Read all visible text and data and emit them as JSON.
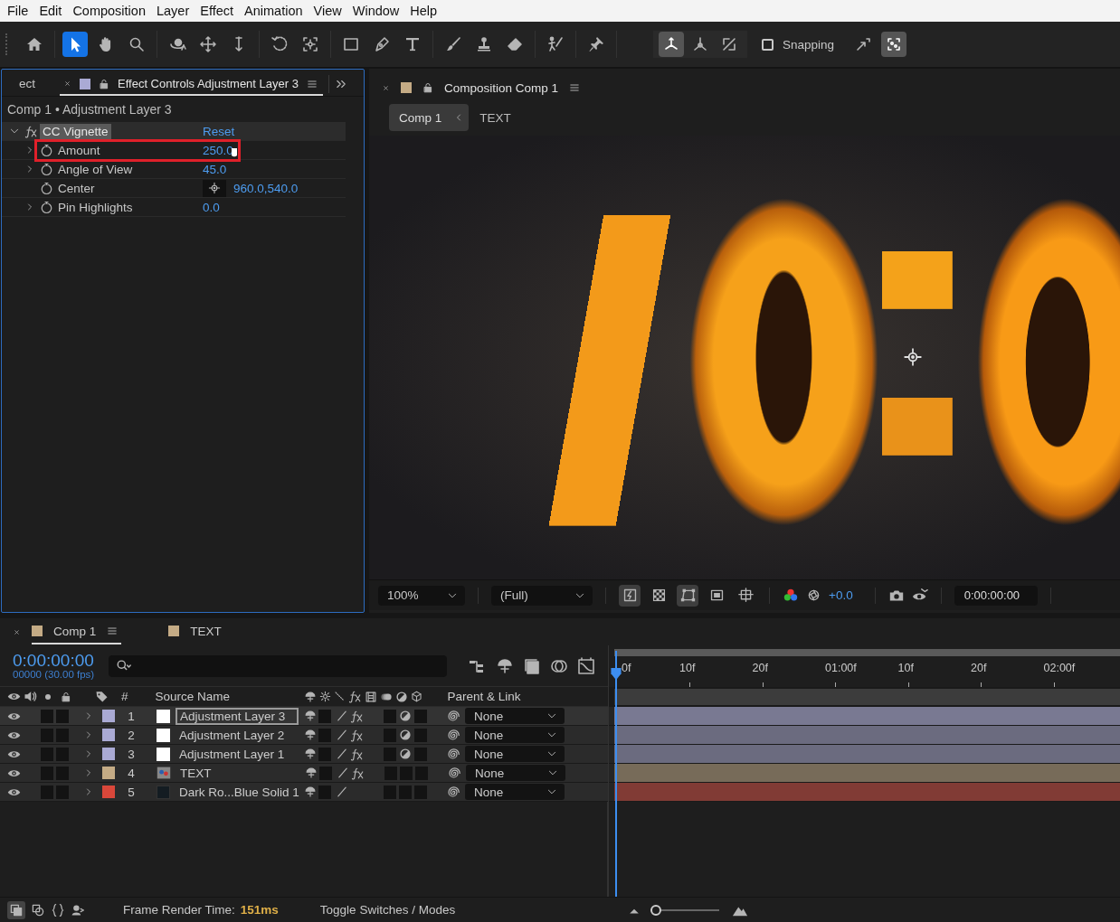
{
  "menu": [
    "File",
    "Edit",
    "Composition",
    "Layer",
    "Effect",
    "Animation",
    "View",
    "Window",
    "Help"
  ],
  "tool_groups": [
    [
      {
        "kind": "home",
        "selected": false
      }
    ],
    [
      {
        "kind": "selection",
        "selected": true
      },
      {
        "kind": "hand",
        "selected": false
      },
      {
        "kind": "zoom",
        "selected": false
      }
    ],
    [
      {
        "kind": "orbit",
        "selected": false
      },
      {
        "kind": "pan",
        "selected": false
      },
      {
        "kind": "dolly",
        "selected": false
      }
    ],
    [
      {
        "kind": "rotate",
        "selected": false
      },
      {
        "kind": "anchor",
        "selected": false
      }
    ],
    [
      {
        "kind": "rectangle",
        "selected": false
      },
      {
        "kind": "pen",
        "selected": false
      },
      {
        "kind": "type",
        "selected": false
      }
    ],
    [
      {
        "kind": "brush",
        "selected": false
      },
      {
        "kind": "stamp",
        "selected": false
      },
      {
        "kind": "eraser",
        "selected": false
      }
    ],
    [
      {
        "kind": "roto",
        "selected": false
      }
    ],
    [
      {
        "kind": "pin",
        "selected": false
      }
    ]
  ],
  "axis_modes": [
    {
      "kind": "local",
      "selected": true
    },
    {
      "kind": "world",
      "selected": false
    },
    {
      "kind": "view",
      "selected": false
    }
  ],
  "snapping": {
    "label": "Snapping",
    "checked": false
  },
  "snap_options": [
    {
      "kind": "edges",
      "selected": false
    },
    {
      "kind": "features",
      "selected": true
    }
  ],
  "effect_panel": {
    "tabs": [
      {
        "label": "ect",
        "selected": false
      },
      {
        "label": "Effect Controls Adjustment Layer 3",
        "selected": true,
        "color": "#aaaad4"
      }
    ],
    "breadcrumb": "Comp 1 • Adjustment Layer 3",
    "effect": {
      "name": "CC Vignette",
      "reset": "Reset",
      "expanded": true
    },
    "properties": [
      {
        "kind": "number",
        "name": "Amount",
        "value": "250.0",
        "expandable": true,
        "highlighted": true
      },
      {
        "kind": "number",
        "name": "Angle of View",
        "value": "45.0",
        "expandable": true,
        "highlighted": false
      },
      {
        "kind": "point",
        "name": "Center",
        "value": "960.0,540.0",
        "expandable": false,
        "highlighted": false
      },
      {
        "kind": "number",
        "name": "Pin Highlights",
        "value": "0.0",
        "expandable": true,
        "highlighted": false
      }
    ]
  },
  "comp_panel": {
    "tab": {
      "label": "Composition Comp 1",
      "color": "#c4ab85"
    },
    "breadcrumbs": [
      {
        "label": "Comp 1",
        "selected": true
      },
      {
        "label": "TEXT",
        "selected": false
      }
    ],
    "viewer_bar": {
      "magnification": "100%",
      "resolution": "(Full)",
      "exposure": "+0.0",
      "timecode": "0:00:00:00",
      "toggles": [
        {
          "kind": "fast-previews",
          "on": true
        },
        {
          "kind": "transparency-grid",
          "on": false
        },
        {
          "kind": "mask-path",
          "on": true
        },
        {
          "kind": "region",
          "on": false
        },
        {
          "kind": "guides",
          "on": false
        }
      ]
    }
  },
  "timeline": {
    "tabs": [
      {
        "label": "Comp 1",
        "selected": true,
        "color": "#c4ab85"
      },
      {
        "label": "TEXT",
        "selected": false,
        "color": "#c4ab85"
      }
    ],
    "timecode": "0:00:00:00",
    "frame_info": "00000 (30.00 fps)",
    "columns": {
      "number": "#",
      "source_name": "Source Name",
      "parent": "Parent & Link"
    },
    "ruler": [
      "0f",
      "10f",
      "20f",
      "01:00f",
      "10f",
      "20f",
      "02:00f"
    ],
    "layers": [
      {
        "number": "1",
        "name": "Adjustment Layer 3",
        "color": "#aaaad4",
        "kind": "adjustment",
        "selected": true,
        "fx": true,
        "adjustment": true,
        "parent": "None"
      },
      {
        "number": "2",
        "name": "Adjustment Layer 2",
        "color": "#aaaad4",
        "kind": "adjustment",
        "selected": false,
        "fx": true,
        "adjustment": true,
        "parent": "None"
      },
      {
        "number": "3",
        "name": "Adjustment Layer 1",
        "color": "#aaaad4",
        "kind": "adjustment",
        "selected": false,
        "fx": true,
        "adjustment": true,
        "parent": "None"
      },
      {
        "number": "4",
        "name": "TEXT",
        "color": "#c4ab85",
        "kind": "composition",
        "selected": false,
        "fx": true,
        "adjustment": false,
        "parent": "None"
      },
      {
        "number": "5",
        "name": "Dark Ro...Blue Solid 1",
        "color": "#d9473a",
        "kind": "solid",
        "selected": false,
        "fx": false,
        "adjustment": false,
        "parent": "None"
      }
    ],
    "zoom_slider": {
      "level": 0.0
    }
  },
  "status_bar": {
    "render_label": "Frame Render Time:",
    "render_time": "151ms",
    "toggle": "Toggle Switches / Modes"
  }
}
